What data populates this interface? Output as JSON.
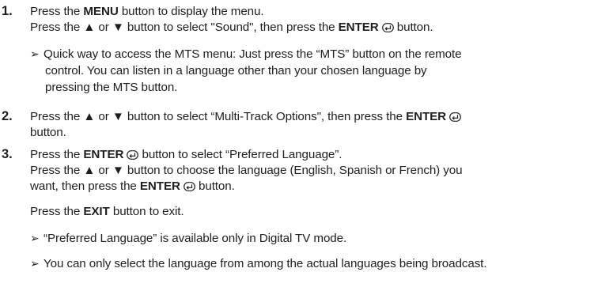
{
  "steps": [
    {
      "number": "1.",
      "line1": {
        "a": "Press the ",
        "b": "MENU",
        "c": " button to display the menu."
      },
      "line2": {
        "a": "Press the ▲ or ▼ button to select \"Sound\", then press the ",
        "b": "ENTER",
        "c": " button."
      },
      "note": {
        "l1": "Quick way to access the MTS menu: Just press the “MTS” button on the remote",
        "l2": "control. You can listen in a language other than your chosen language by",
        "l3": "pressing the MTS button."
      }
    },
    {
      "number": "2.",
      "line1": {
        "a": "Press the ▲ or ▼ button to select “Multi-Track Options\", then press the ",
        "b": "ENTER"
      },
      "line2": "button."
    },
    {
      "number": "3.",
      "line1": {
        "a": "Press the ",
        "b": "ENTER",
        "c": " button to select “Preferred Language”."
      },
      "line2": "Press the ▲ or ▼ button to choose the language (English, Spanish or French) you",
      "line3": {
        "a": "want, then press the ",
        "b": "ENTER",
        "c": " button."
      },
      "exit": {
        "a": "Press the ",
        "b": "EXIT",
        "c": " button to exit."
      },
      "notes": [
        "“Preferred Language” is available only in Digital TV mode.",
        "You can only select the language from among the actual languages being broadcast."
      ]
    }
  ],
  "icons": {
    "arrow": "note-arrow-icon",
    "enter": "enter-icon"
  }
}
